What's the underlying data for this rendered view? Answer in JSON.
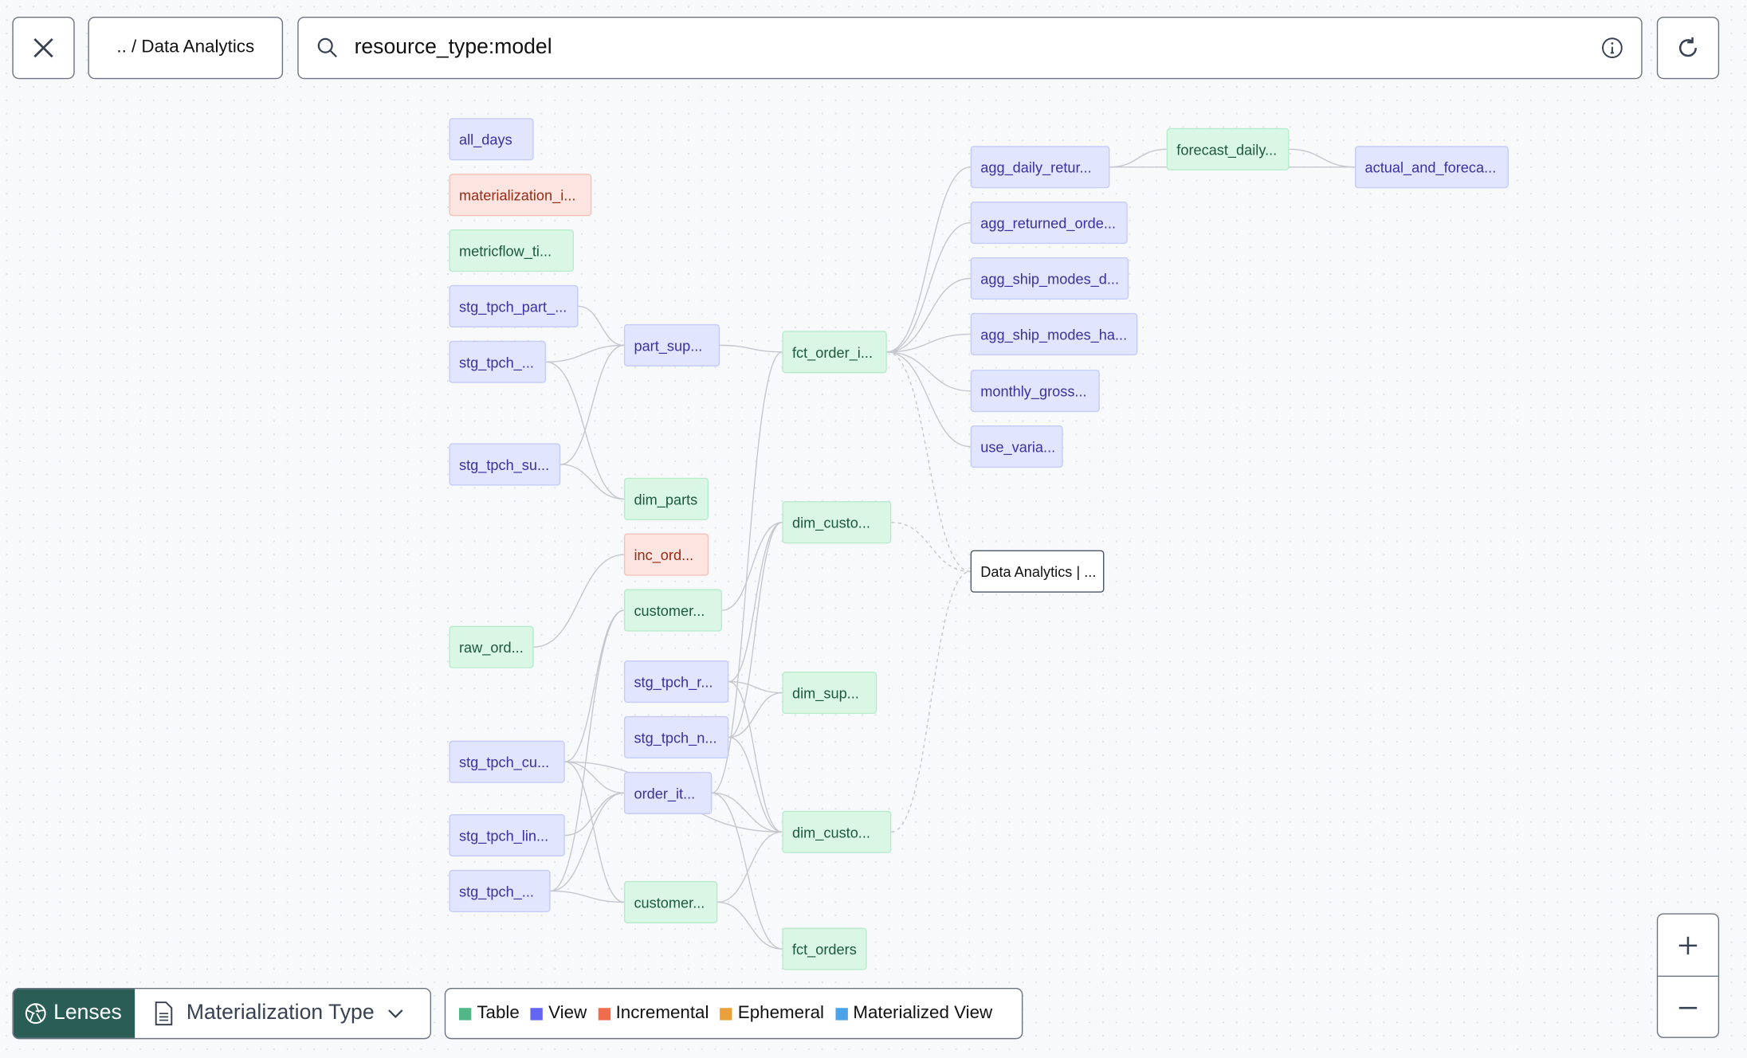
{
  "toolbar": {
    "close_icon": "close-icon",
    "breadcrumb": ".. / Data Analytics",
    "search_value": "resource_type:model",
    "search_icon": "search-icon",
    "info_icon": "info-icon",
    "refresh_icon": "refresh-icon"
  },
  "lenses": {
    "label": "Lenses",
    "selected": "Materialization Type"
  },
  "legend": [
    {
      "label": "Table",
      "color": "#52b788"
    },
    {
      "label": "View",
      "color": "#6366f1"
    },
    {
      "label": "Incremental",
      "color": "#ef6c4d"
    },
    {
      "label": "Ephemeral",
      "color": "#eba13a"
    },
    {
      "label": "Materialized View",
      "color": "#4aa3e8"
    }
  ],
  "zoom": {
    "in": "+",
    "out": "−"
  },
  "nodes": [
    {
      "id": "all_days",
      "label": "all_days",
      "type": "view"
    },
    {
      "id": "mat_i",
      "label": "materialization_i...",
      "type": "incremental"
    },
    {
      "id": "metricflow",
      "label": "metricflow_ti...",
      "type": "table"
    },
    {
      "id": "stg_part",
      "label": "stg_tpch_part_...",
      "type": "view"
    },
    {
      "id": "stg_a",
      "label": "stg_tpch_...",
      "type": "view"
    },
    {
      "id": "stg_su",
      "label": "stg_tpch_su...",
      "type": "view"
    },
    {
      "id": "raw_ord",
      "label": "raw_ord...",
      "type": "table"
    },
    {
      "id": "stg_cu",
      "label": "stg_tpch_cu...",
      "type": "view"
    },
    {
      "id": "stg_lin",
      "label": "stg_tpch_lin...",
      "type": "view"
    },
    {
      "id": "stg_b",
      "label": "stg_tpch_...",
      "type": "view"
    },
    {
      "id": "part_sup",
      "label": "part_sup...",
      "type": "view"
    },
    {
      "id": "dim_parts",
      "label": "dim_parts",
      "type": "table"
    },
    {
      "id": "inc_ord",
      "label": "inc_ord...",
      "type": "incremental"
    },
    {
      "id": "customer1",
      "label": "customer...",
      "type": "table"
    },
    {
      "id": "stg_r",
      "label": "stg_tpch_r...",
      "type": "view"
    },
    {
      "id": "stg_n",
      "label": "stg_tpch_n...",
      "type": "view"
    },
    {
      "id": "order_it",
      "label": "order_it...",
      "type": "view"
    },
    {
      "id": "customer2",
      "label": "customer...",
      "type": "table"
    },
    {
      "id": "fct_order_i",
      "label": "fct_order_i...",
      "type": "table"
    },
    {
      "id": "dim_custo1",
      "label": "dim_custo...",
      "type": "table"
    },
    {
      "id": "dim_sup",
      "label": "dim_sup...",
      "type": "table"
    },
    {
      "id": "dim_custo2",
      "label": "dim_custo...",
      "type": "table"
    },
    {
      "id": "fct_orders",
      "label": "fct_orders",
      "type": "table"
    },
    {
      "id": "agg_daily",
      "label": "agg_daily_retur...",
      "type": "view"
    },
    {
      "id": "agg_ret",
      "label": "agg_returned_orde...",
      "type": "view"
    },
    {
      "id": "agg_ship_d",
      "label": "agg_ship_modes_d...",
      "type": "view"
    },
    {
      "id": "agg_ship_h",
      "label": "agg_ship_modes_ha...",
      "type": "view"
    },
    {
      "id": "monthly",
      "label": "monthly_gross...",
      "type": "view"
    },
    {
      "id": "use_varia",
      "label": "use_varia...",
      "type": "view"
    },
    {
      "id": "exposure",
      "label": "Data Analytics | ...",
      "type": "exposure"
    },
    {
      "id": "forecast",
      "label": "forecast_daily...",
      "type": "table"
    },
    {
      "id": "actual",
      "label": "actual_and_foreca...",
      "type": "view"
    }
  ],
  "edges": [
    [
      "stg_part",
      "part_sup"
    ],
    [
      "stg_a",
      "part_sup"
    ],
    [
      "stg_su",
      "part_sup"
    ],
    [
      "stg_a",
      "dim_parts"
    ],
    [
      "stg_su",
      "dim_parts"
    ],
    [
      "part_sup",
      "fct_order_i"
    ],
    [
      "order_it",
      "fct_order_i"
    ],
    [
      "fct_order_i",
      "agg_daily"
    ],
    [
      "fct_order_i",
      "agg_ret"
    ],
    [
      "fct_order_i",
      "agg_ship_d"
    ],
    [
      "fct_order_i",
      "agg_ship_h"
    ],
    [
      "fct_order_i",
      "monthly"
    ],
    [
      "fct_order_i",
      "use_varia"
    ],
    [
      "fct_order_i",
      "exposure",
      "dashed"
    ],
    [
      "dim_custo1",
      "exposure",
      "dashed"
    ],
    [
      "dim_custo2",
      "exposure",
      "dashed"
    ],
    [
      "agg_daily",
      "forecast"
    ],
    [
      "forecast",
      "actual"
    ],
    [
      "agg_daily",
      "actual"
    ],
    [
      "raw_ord",
      "inc_ord"
    ],
    [
      "customer1",
      "dim_custo1"
    ],
    [
      "stg_cu",
      "customer1"
    ],
    [
      "stg_cu",
      "customer2"
    ],
    [
      "stg_cu",
      "order_it"
    ],
    [
      "stg_cu",
      "dim_custo2"
    ],
    [
      "stg_lin",
      "order_it"
    ],
    [
      "stg_b",
      "customer2"
    ],
    [
      "stg_b",
      "order_it"
    ],
    [
      "stg_b",
      "customer1"
    ],
    [
      "stg_r",
      "dim_custo1"
    ],
    [
      "stg_r",
      "dim_sup"
    ],
    [
      "stg_r",
      "dim_custo2"
    ],
    [
      "stg_n",
      "dim_custo1"
    ],
    [
      "stg_n",
      "dim_sup"
    ],
    [
      "stg_n",
      "dim_custo2"
    ],
    [
      "order_it",
      "fct_orders"
    ],
    [
      "order_it",
      "dim_custo2"
    ],
    [
      "customer2",
      "dim_custo2"
    ],
    [
      "customer2",
      "fct_orders"
    ]
  ]
}
